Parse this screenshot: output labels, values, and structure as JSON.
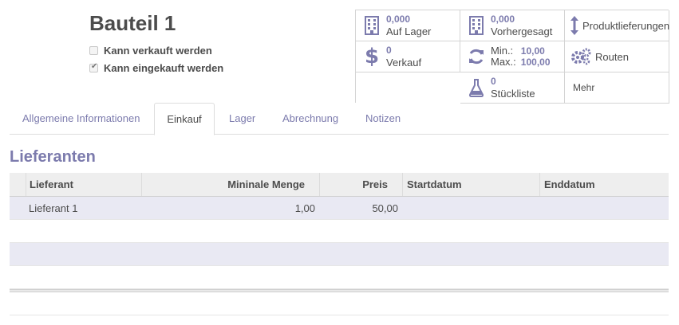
{
  "product": {
    "name": "Bauteil 1",
    "checkboxes": [
      {
        "label": "Kann verkauft werden",
        "checked": false
      },
      {
        "label": "Kann eingekauft werden",
        "checked": true
      }
    ]
  },
  "smart_buttons": {
    "on_hand": {
      "value": "0,000",
      "label": "Auf Lager",
      "icon": "building-icon"
    },
    "forecast": {
      "value": "0,000",
      "label": "Vorhergesagt",
      "icon": "building-icon"
    },
    "moves": {
      "label": "Produktlieferungen",
      "icon": "up-down-arrow-icon"
    },
    "sales": {
      "value": "0",
      "label": "Verkauf",
      "icon": "dollar-icon"
    },
    "minmax": {
      "min_label": "Min.:",
      "min_value": "10,00",
      "max_label": "Max.:",
      "max_value": "100,00",
      "icon": "refresh-icon"
    },
    "routes": {
      "label": "Routen",
      "icon": "gears-icon"
    },
    "bom": {
      "value": "0",
      "label": "Stückliste",
      "icon": "flask-icon"
    },
    "more": {
      "label": "Mehr"
    }
  },
  "tabs": [
    "Allgemeine Informationen",
    "Einkauf",
    "Lager",
    "Abrechnung",
    "Notizen"
  ],
  "active_tab": "Einkauf",
  "section_title": "Lieferanten",
  "suppliers_table": {
    "columns": [
      "Lieferant",
      "Mininale Menge",
      "Preis",
      "Startdatum",
      "Enddatum"
    ],
    "rows": [
      {
        "supplier": "Lieferant 1",
        "min_qty": "1,00",
        "price": "50,00",
        "start": "",
        "end": ""
      }
    ]
  },
  "colors": {
    "accent": "#7c7bad",
    "text": "#4c4c4c",
    "border": "#d4d4d4",
    "row_alt": "#e9e9f3"
  }
}
